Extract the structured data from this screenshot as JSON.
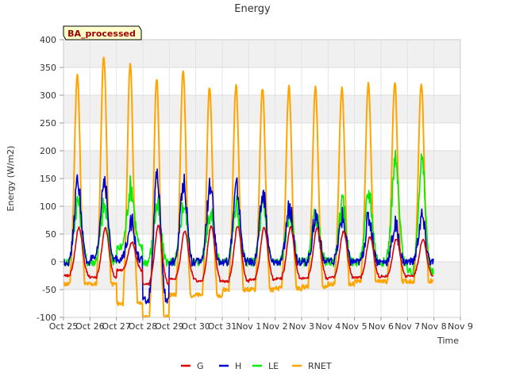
{
  "chart_data": {
    "type": "line",
    "title": "Energy",
    "xlabel": "Time",
    "ylabel": "Energy (W/m2)",
    "ylim": [
      -100,
      400
    ],
    "yticks": [
      -100,
      -50,
      0,
      50,
      100,
      150,
      200,
      250,
      300,
      350,
      400
    ],
    "xlim": [
      0,
      15
    ],
    "xtick_labels": [
      "Oct 25",
      "Oct 26",
      "Oct 27",
      "Oct 28",
      "Oct 29",
      "Oct 30",
      "Oct 31",
      "Nov 1",
      "Nov 2",
      "Nov 3",
      "Nov 4",
      "Nov 5",
      "Nov 6",
      "Nov 7",
      "Nov 8",
      "Nov 9"
    ],
    "grid": true,
    "background_bands": true,
    "legend_position": "bottom-center",
    "annotation": "BA_processed",
    "series": [
      {
        "name": "G",
        "color": "#dd0000",
        "peak_hour": 14,
        "width": 3.2,
        "night": [
          -25,
          -28,
          -15,
          -40,
          -30,
          -35,
          -35,
          -32,
          -30,
          -30,
          -28,
          -28,
          -26,
          -25
        ],
        "peak": [
          62,
          60,
          35,
          65,
          55,
          65,
          65,
          62,
          62,
          62,
          55,
          45,
          42,
          40
        ]
      },
      {
        "name": "H",
        "color": "#0000cc",
        "peak_hour": 13,
        "width": 3.0,
        "night": [
          0,
          5,
          5,
          -70,
          0,
          0,
          0,
          0,
          0,
          0,
          0,
          0,
          0,
          0
        ],
        "peak": [
          145,
          150,
          75,
          155,
          145,
          135,
          135,
          120,
          100,
          85,
          80,
          80,
          65,
          80
        ]
      },
      {
        "name": "LE",
        "color": "#00ee00",
        "peak_hour": 13,
        "width": 3.2,
        "night": [
          0,
          0,
          25,
          0,
          0,
          0,
          0,
          0,
          0,
          0,
          0,
          0,
          0,
          -20
        ],
        "peak": [
          110,
          100,
          135,
          100,
          105,
          90,
          100,
          95,
          90,
          85,
          100,
          125,
          180,
          180
        ]
      },
      {
        "name": "RNET",
        "color": "#ffa500",
        "peak_hour": 12.5,
        "width": 2.6,
        "night": [
          -40,
          -40,
          -75,
          -100,
          -60,
          -60,
          -50,
          -50,
          -48,
          -45,
          -40,
          -35,
          -35,
          -35
        ],
        "peak": [
          337,
          372,
          358,
          330,
          345,
          315,
          318,
          312,
          316,
          315,
          312,
          320,
          323,
          323
        ]
      }
    ]
  }
}
